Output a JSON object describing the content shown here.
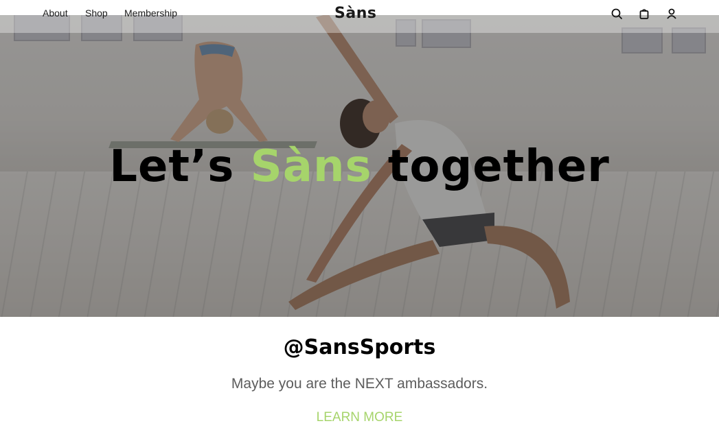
{
  "nav": {
    "links": [
      "About",
      "Shop",
      "Membership"
    ],
    "logo": "Sàns",
    "icons": [
      "search-icon",
      "bag-icon",
      "user-icon"
    ]
  },
  "hero": {
    "headline_before": "Let’s",
    "headline_accent": "Sàns",
    "headline_after": "together",
    "accent_color": "#a6d46b"
  },
  "ambassador": {
    "handle": "@SansSports",
    "subtitle": "Maybe you are the NEXT ambassadors.",
    "cta": "LEARN MORE"
  }
}
